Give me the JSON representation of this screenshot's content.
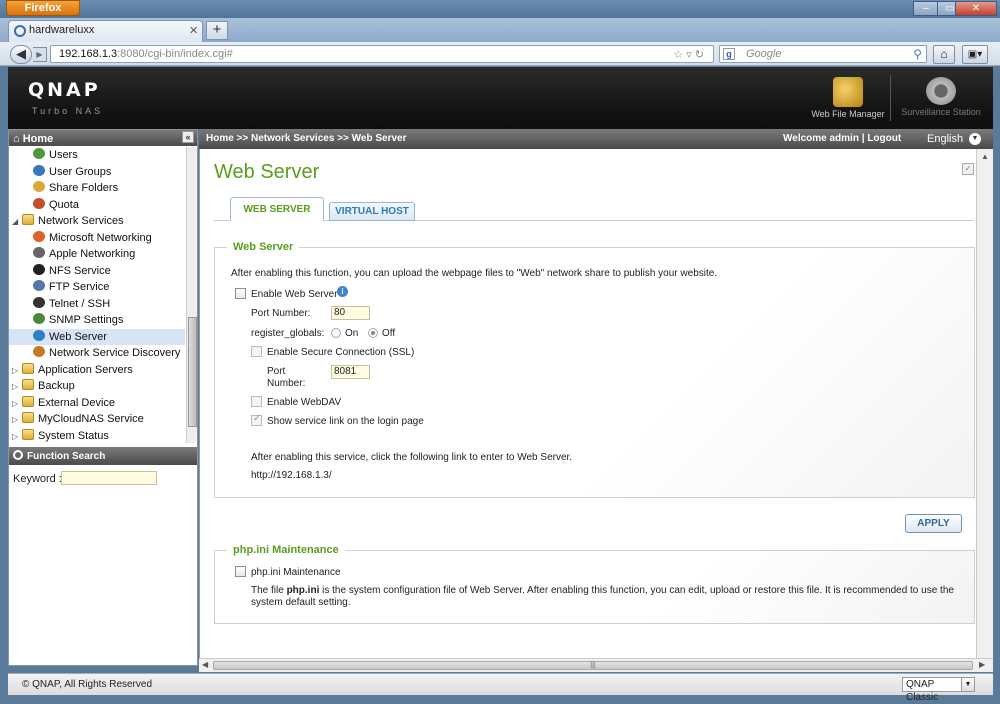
{
  "browser": {
    "app_button": "Firefox",
    "tab_title": "hardwareluxx",
    "new_tab": "+",
    "url_host": "192.168.1.3",
    "url_rest": ":8080/cgi-bin/index.cgi#",
    "search_placeholder": "Google",
    "window_buttons": [
      "–",
      "▭",
      "✕"
    ]
  },
  "header": {
    "logo": "QNAP",
    "subtitle": "Turbo NAS",
    "apps": [
      {
        "label": "Web File Manager",
        "icon": "folder-magnifier-icon"
      },
      {
        "label": "Surveillance Station",
        "icon": "camera-dome-icon"
      }
    ]
  },
  "sidebar": {
    "title": "Home",
    "tree": [
      {
        "label": "Users",
        "level": 2,
        "icon": "users-icon",
        "color": "#4c9a3b"
      },
      {
        "label": "User Groups",
        "level": 2,
        "icon": "user-groups-icon",
        "color": "#3a78b8"
      },
      {
        "label": "Share Folders",
        "level": 2,
        "icon": "share-folder-icon",
        "color": "#d8a93a"
      },
      {
        "label": "Quota",
        "level": 2,
        "icon": "quota-icon",
        "color": "#c44d2a"
      },
      {
        "label": "Network Services",
        "level": 1,
        "icon": "folder-icon",
        "expanded": true
      },
      {
        "label": "Microsoft Networking",
        "level": 2,
        "icon": "windows-icon",
        "color": "#e0602b"
      },
      {
        "label": "Apple Networking",
        "level": 2,
        "icon": "apple-icon",
        "color": "#666666"
      },
      {
        "label": "NFS Service",
        "level": 2,
        "icon": "linux-penguin-icon",
        "color": "#222222"
      },
      {
        "label": "FTP Service",
        "level": 2,
        "icon": "ftp-icon",
        "color": "#5577aa"
      },
      {
        "label": "Telnet / SSH",
        "level": 2,
        "icon": "terminal-icon",
        "color": "#333333"
      },
      {
        "label": "SNMP Settings",
        "level": 2,
        "icon": "snmp-icon",
        "color": "#4a8a3a"
      },
      {
        "label": "Web Server",
        "level": 2,
        "icon": "globe-icon",
        "color": "#2f7fc4",
        "selected": true
      },
      {
        "label": "Network Service Discovery",
        "level": 2,
        "icon": "discovery-icon",
        "color": "#c77a25"
      },
      {
        "label": "Application Servers",
        "level": 1,
        "icon": "folder-icon"
      },
      {
        "label": "Backup",
        "level": 1,
        "icon": "folder-icon"
      },
      {
        "label": "External Device",
        "level": 1,
        "icon": "folder-icon"
      },
      {
        "label": "MyCloudNAS Service",
        "level": 1,
        "icon": "folder-icon"
      },
      {
        "label": "System Status",
        "level": 1,
        "icon": "folder-icon"
      }
    ],
    "function_search": "Function Search",
    "keyword_label": "Keyword :"
  },
  "breadcrumb": "Home >> Network Services >> Web Server",
  "user": {
    "welcome": "Welcome admin",
    "separator": "|",
    "logout": "Logout"
  },
  "language": "English",
  "page": {
    "title": "Web Server",
    "tabs": [
      "WEB SERVER",
      "VIRTUAL HOST"
    ],
    "web_server": {
      "legend": "Web Server",
      "description": "After enabling this function, you can upload the webpage files to \"Web\" network share to publish your website.",
      "enable_label": "Enable Web Server",
      "port_label": "Port Number:",
      "port_value": "80",
      "register_globals_label": "register_globals:",
      "on_label": "On",
      "off_label": "Off",
      "ssl_label": "Enable Secure Connection (SSL)",
      "ssl_port_label_1": "Port",
      "ssl_port_label_2": "Number:",
      "ssl_port_value": "8081",
      "webdav_label": "Enable WebDAV",
      "show_link_label": "Show service link on the login page",
      "link_note": "After enabling this service, click the following link to enter to Web Server.",
      "link_url": "http://192.168.1.3/"
    },
    "apply": "APPLY",
    "php": {
      "legend": "php.ini Maintenance",
      "checkbox_label": "php.ini Maintenance",
      "desc_prefix": "The file ",
      "desc_bold": "php.ini",
      "desc_line1": " is the system configuration file of Web Server. After enabling this function, you can edit, upload or restore this file. It is recommended to use the",
      "desc_line2": "system default setting."
    }
  },
  "footer": {
    "copyright": "© QNAP, All Rights Reserved",
    "theme": "QNAP Classic"
  }
}
